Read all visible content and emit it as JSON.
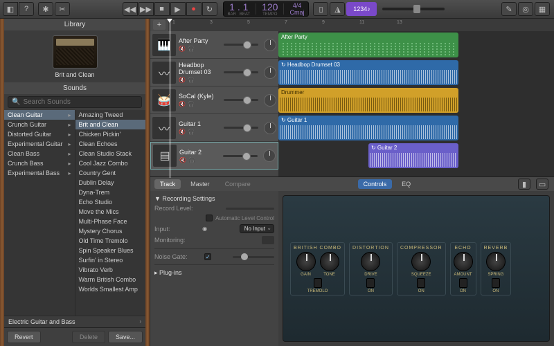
{
  "toolbar": {
    "lcd": {
      "bars": "1",
      "beats": "1",
      "bars_lbl": "BAR",
      "beats_lbl": "BEAT",
      "tempo": "120",
      "tempo_lbl": "TEMPO",
      "sig": "4/4",
      "key": "Cmaj"
    },
    "note_display": "1234"
  },
  "library": {
    "title": "Library",
    "preview_name": "Brit and Clean",
    "sounds_title": "Sounds",
    "search_placeholder": "Search Sounds",
    "col1": [
      {
        "label": "Clean Guitar",
        "sel": true
      },
      {
        "label": "Crunch Guitar"
      },
      {
        "label": "Distorted Guitar"
      },
      {
        "label": "Experimental Guitar"
      },
      {
        "label": "Clean Bass"
      },
      {
        "label": "Crunch Bass"
      },
      {
        "label": "Experimental Bass"
      }
    ],
    "col2": [
      "Amazing Tweed",
      "Brit and Clean",
      "Chicken Pickin'",
      "Clean Echoes",
      "Clean Studio Stack",
      "Cool Jazz Combo",
      "Country Gent",
      "Dublin Delay",
      "Dyna-Trem",
      "Echo Studio",
      "Move the Mics",
      "Multi-Phase Face",
      "Mystery Chorus",
      "Old Time Tremolo",
      "Spin Speaker Blues",
      "Surfin' in Stereo",
      "Vibrato Verb",
      "Warm British Combo",
      "Worlds Smallest Amp"
    ],
    "category": "Electric Guitar and Bass",
    "revert": "Revert",
    "delete": "Delete",
    "save": "Save..."
  },
  "ruler": {
    "marks": [
      "1",
      "3",
      "5",
      "7",
      "9",
      "11",
      "13"
    ]
  },
  "tracks": [
    {
      "name": "After Party",
      "icon": "keys",
      "color": "green",
      "start": 0,
      "len": 260
    },
    {
      "name": "Headbop Drumset 03",
      "icon": "wave",
      "color": "blue",
      "start": 0,
      "len": 260,
      "loop": true
    },
    {
      "name": "SoCal (Kyle)",
      "icon": "drums",
      "color": "yellow",
      "start": 0,
      "len": 260,
      "label": "Drummer"
    },
    {
      "name": "Guitar 1",
      "icon": "wave",
      "color": "blue",
      "start": 0,
      "len": 260,
      "loop": true
    },
    {
      "name": "Guitar 2",
      "icon": "amp",
      "color": "purple",
      "start": 130,
      "len": 130,
      "sel": true,
      "loop": true
    }
  ],
  "smart": {
    "tabs": {
      "track": "Track",
      "master": "Master",
      "compare": "Compare",
      "controls": "Controls",
      "eq": "EQ"
    },
    "rec": {
      "title": "Recording Settings",
      "record_level": "Record Level:",
      "auto": "Automatic Level Control",
      "input_lbl": "Input:",
      "input_val": "No Input",
      "monitoring": "Monitoring:",
      "noise_gate": "Noise Gate:",
      "plugins": "Plug-ins"
    },
    "amp": {
      "groups": [
        {
          "title": "BRITISH COMBO",
          "knobs": [
            "GAIN",
            "TONE"
          ],
          "toggles": [
            "TREMOLO"
          ]
        },
        {
          "title": "DISTORTION",
          "knobs": [
            "DRIVE"
          ],
          "toggles": [
            "ON"
          ]
        },
        {
          "title": "COMPRESSOR",
          "knobs": [
            "SQUEEZE"
          ],
          "toggles": [
            "ON"
          ]
        },
        {
          "title": "ECHO",
          "knobs": [
            "AMOUNT"
          ],
          "toggles": [
            "ON"
          ]
        },
        {
          "title": "REVERB",
          "knobs": [
            "SPRING"
          ],
          "toggles": [
            "ON"
          ]
        }
      ]
    }
  }
}
